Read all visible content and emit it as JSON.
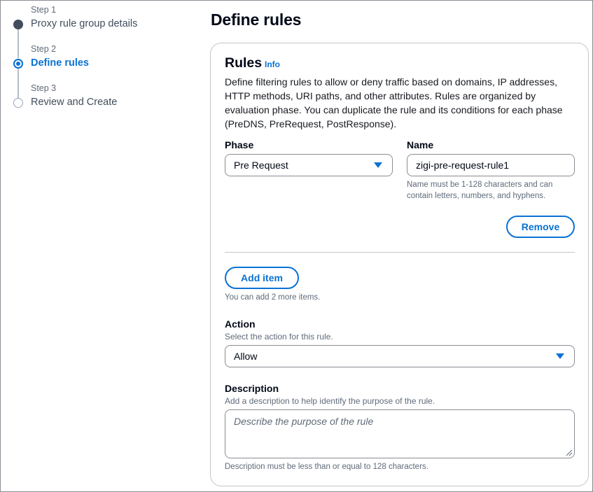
{
  "steps": [
    {
      "number": "Step 1",
      "title": "Proxy rule group details",
      "state": "done"
    },
    {
      "number": "Step 2",
      "title": "Define rules",
      "state": "active"
    },
    {
      "number": "Step 3",
      "title": "Review and Create",
      "state": "future"
    }
  ],
  "page": {
    "title": "Define rules"
  },
  "rules": {
    "title": "Rules",
    "info_label": "Info",
    "description": "Define filtering rules to allow or deny traffic based on domains, IP addresses, HTTP methods, URI paths, and other attributes. Rules are organized by evaluation phase. You can duplicate the rule and its conditions for each phase (PreDNS, PreRequest, PostResponse).",
    "phase": {
      "label": "Phase",
      "value": "Pre Request"
    },
    "name": {
      "label": "Name",
      "value": "zigi-pre-request-rule1",
      "hint": "Name must be 1-128 characters and can contain letters, numbers, and hyphens."
    },
    "remove_label": "Remove",
    "add_item_label": "Add item",
    "add_item_hint": "You can add 2 more items.",
    "action": {
      "label": "Action",
      "sublabel": "Select the action for this rule.",
      "value": "Allow"
    },
    "description_field": {
      "label": "Description",
      "sublabel": "Add a description to help identify the purpose of the rule.",
      "placeholder": "Describe the purpose of the rule",
      "hint": "Description must be less than or equal to 128 characters."
    }
  },
  "colors": {
    "accent": "#0972d3",
    "text": "#16191f",
    "muted": "#5f6b7a",
    "border": "#8c8c94"
  }
}
